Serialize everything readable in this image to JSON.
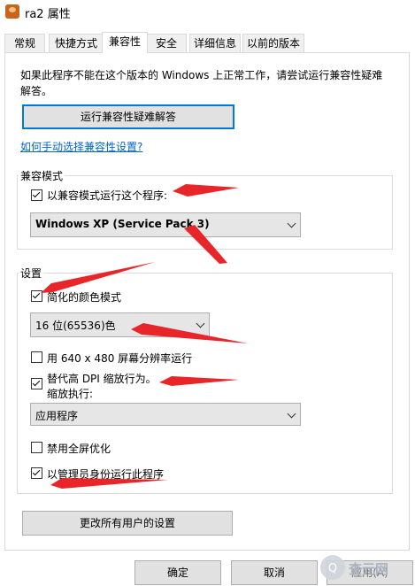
{
  "window": {
    "title": "ra2 属性"
  },
  "tabs": [
    {
      "label": "常规"
    },
    {
      "label": "快捷方式"
    },
    {
      "label": "兼容性"
    },
    {
      "label": "安全"
    },
    {
      "label": "详细信息"
    },
    {
      "label": "以前的版本"
    }
  ],
  "intro": "如果此程序不能在这个版本的 Windows 上正常工作，请尝试运行兼容性疑难解答。",
  "troubleshoot_button": "运行兼容性疑难解答",
  "manual_link": "如何手动选择兼容性设置?",
  "compat_mode": {
    "group_label": "兼容模式",
    "checkbox_label": "以兼容模式运行这个程序:",
    "checked": true,
    "os_select": "Windows XP (Service Pack 3)"
  },
  "settings": {
    "group_label": "设置",
    "reduced_color": {
      "label": "简化的颜色模式",
      "checked": true
    },
    "color_select": "16 位(65536)色",
    "res_640": {
      "label": "用 640 x 480 屏幕分辨率运行",
      "checked": false
    },
    "dpi_override": {
      "label_line1": "替代高 DPI 缩放行为。",
      "label_line2": "缩放执行:",
      "checked": true
    },
    "dpi_select": "应用程序",
    "disable_fullscreen": {
      "label": "禁用全屏优化",
      "checked": false
    },
    "run_as_admin": {
      "label": "以管理员身份运行此程序",
      "checked": true
    }
  },
  "change_all_users_button": "更改所有用户的设置",
  "footer": {
    "ok": "确定",
    "cancel": "取消",
    "apply": "应用(A)"
  },
  "watermark": {
    "text": "查元网"
  },
  "colors": {
    "accent": "#0078d7",
    "link": "#0066cc",
    "arrow": "#e8262a"
  }
}
